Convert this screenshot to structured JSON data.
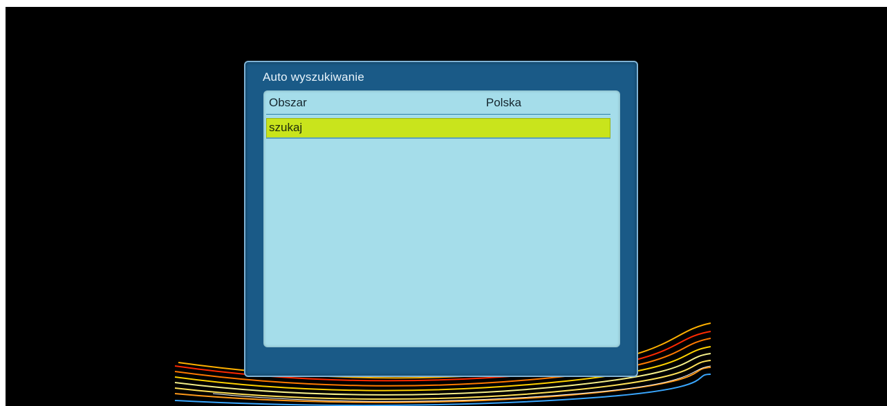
{
  "dialog": {
    "title": "Auto wyszukiwanie"
  },
  "rows": [
    {
      "label": "Obszar",
      "value": "Polska"
    },
    {
      "label": "szukaj"
    }
  ],
  "colors": {
    "screen_bg": "#000000",
    "dialog_bg": "#1a5a87",
    "panel_bg": "#a5ddea",
    "highlight": "#c9e41c"
  }
}
